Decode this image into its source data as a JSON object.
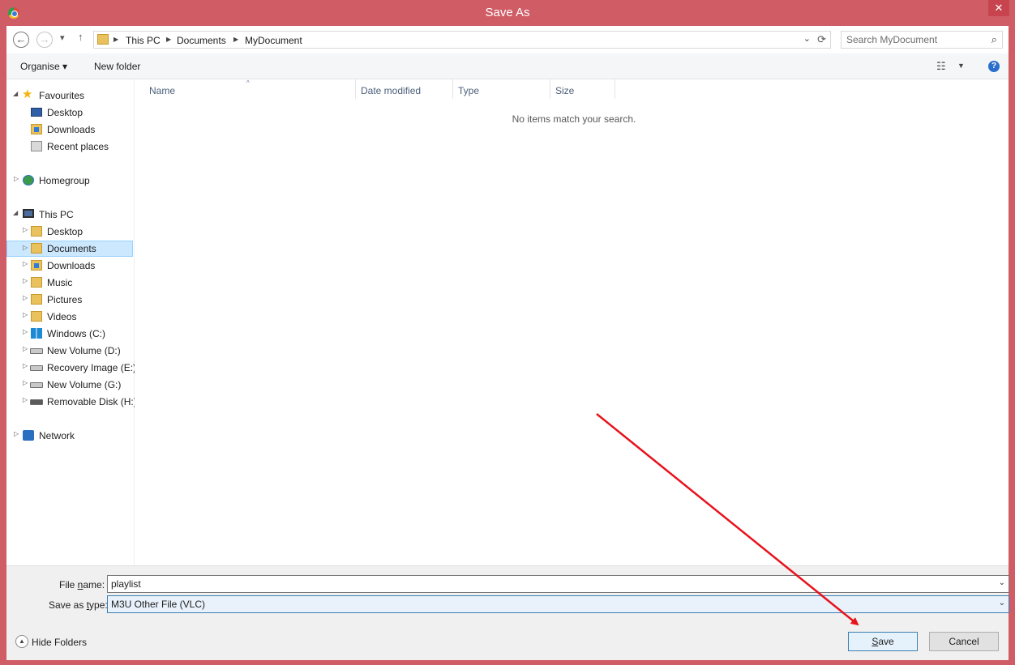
{
  "window": {
    "title": "Save As",
    "close_glyph": "✕",
    "accent_color": "#d05d66"
  },
  "address": {
    "back_glyph": "←",
    "forward_glyph": "→",
    "recent_glyph": "▾",
    "up_glyph": "↑",
    "crumbs": [
      "This PC",
      "Documents",
      "MyDocument"
    ],
    "refresh_glyph": "⟳",
    "dropdown_glyph": "⌄",
    "search_placeholder": "Search MyDocument",
    "search_glyph": "⌕"
  },
  "toolbar": {
    "organise_label": "Organise ▾",
    "new_folder_label": "New folder",
    "view_glyph": "☷",
    "view_dd_glyph": "▼",
    "help_glyph": "?"
  },
  "nav": {
    "favourites": {
      "label": "Favourites",
      "items": [
        "Desktop",
        "Downloads",
        "Recent places"
      ]
    },
    "homegroup": {
      "label": "Homegroup"
    },
    "this_pc": {
      "label": "This PC",
      "items": [
        "Desktop",
        "Documents",
        "Downloads",
        "Music",
        "Pictures",
        "Videos",
        "Windows (C:)",
        "New Volume (D:)",
        "Recovery Image (E:)",
        "New Volume (G:)",
        "Removable Disk (H:)"
      ]
    },
    "network": {
      "label": "Network"
    },
    "expanded_glyph": "◢",
    "collapsed_glyph": "▷",
    "star_glyph": "★"
  },
  "content": {
    "columns": [
      "Name",
      "Date modified",
      "Type",
      "Size"
    ],
    "sort_glyph": "^",
    "empty_message": "No items match your search."
  },
  "form": {
    "file_name_label_pre": "File ",
    "file_name_label_u": "n",
    "file_name_label_post": "ame:",
    "file_name_value": "playlist",
    "save_type_label_pre": "Save as ",
    "save_type_label_u": "t",
    "save_type_label_post": "ype:",
    "save_type_value": "M3U Other File (VLC)",
    "dropdown_glyph": "⌄",
    "hide_folders_label": "Hide Folders",
    "hide_folders_glyph": "▲",
    "save_label_u": "S",
    "save_label_rest": "ave",
    "cancel_label": "Cancel"
  }
}
